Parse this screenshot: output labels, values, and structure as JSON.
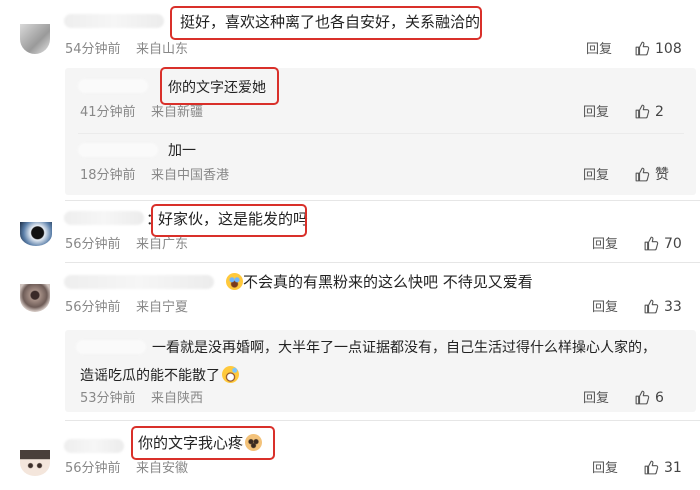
{
  "comments": [
    {
      "text": "挺好，喜欢这种离了也各自安好，关系融洽的",
      "time": "54分钟前",
      "location": "来自山东",
      "reply_label": "回复",
      "likes": "108",
      "subs": [
        {
          "text": "你的文字还爱她",
          "time": "41分钟前",
          "location": "来自新疆",
          "reply_label": "回复",
          "likes": "2"
        },
        {
          "text": "加一",
          "time": "18分钟前",
          "location": "来自中国香港",
          "reply_label": "回复",
          "likes": "赞"
        }
      ]
    },
    {
      "name_suffix": "：",
      "text": "好家伙，这是能发的吗",
      "time": "56分钟前",
      "location": "来自广东",
      "reply_label": "回复",
      "likes": "70"
    },
    {
      "text": "不会真的有黑粉来的这么快吧 不待见又爱看",
      "time": "56分钟前",
      "location": "来自宁夏",
      "reply_label": "回复",
      "likes": "33",
      "subs": [
        {
          "text_line1": "一看就是没再婚啊，大半年了一点证据都没有，自己生活过得什么样操心人家的，",
          "text_line2": "造谣吃瓜的能不能散了",
          "time": "53分钟前",
          "location": "来自陕西",
          "reply_label": "回复",
          "likes": "6"
        }
      ]
    },
    {
      "text": "你的文字我心疼",
      "time": "56分钟前",
      "location": "来自安徽",
      "reply_label": "回复",
      "likes": "31"
    }
  ],
  "colors": {
    "highlight_box": "#d9302a",
    "sub_bg": "#f5f5f5",
    "meta": "#888888"
  },
  "icons": [
    "thumbs-up-icon",
    "laugh-cry-emoji",
    "grin-sweat-emoji",
    "dog-face-emoji"
  ]
}
